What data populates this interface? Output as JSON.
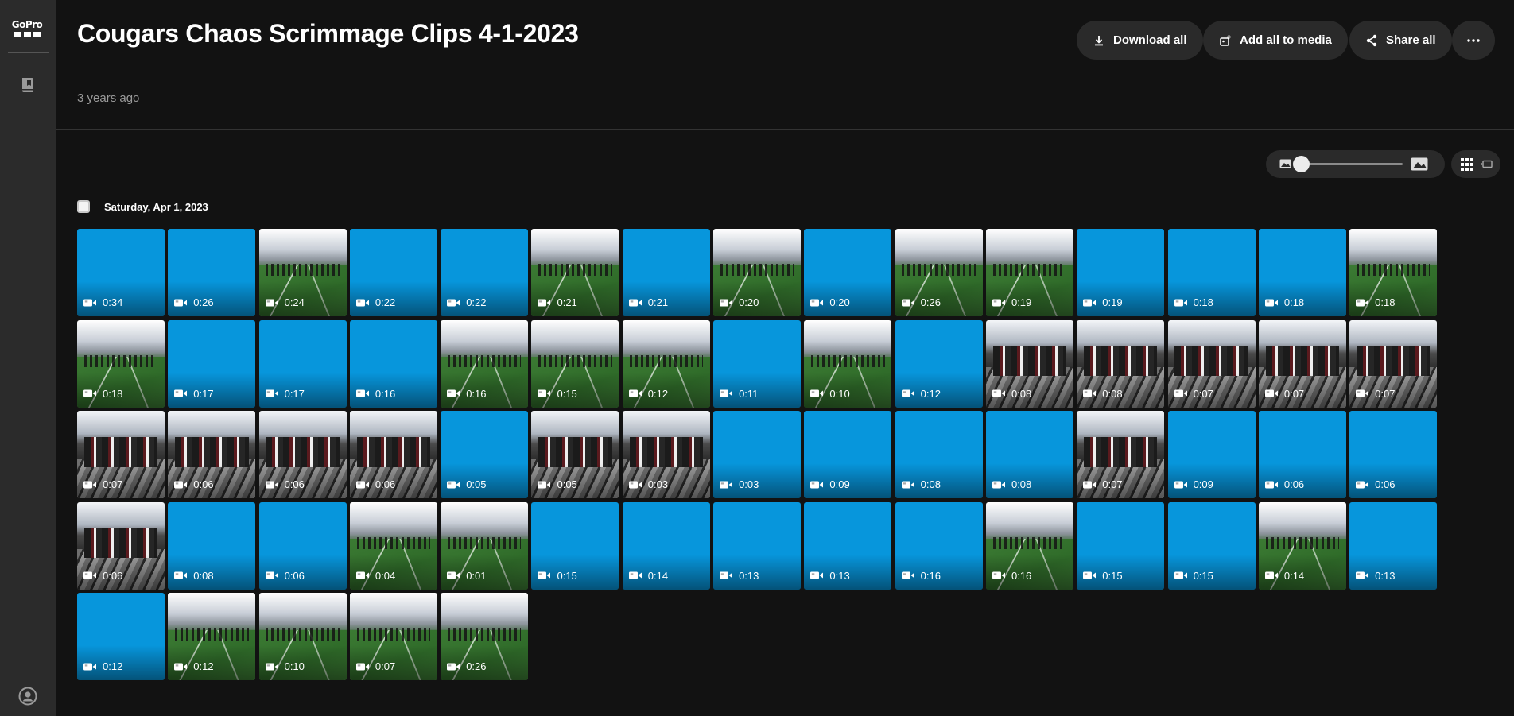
{
  "brand": {
    "logo_text": "GoPro"
  },
  "album": {
    "title": "Cougars Chaos Scrimmage Clips 4-1-2023",
    "created": "3 years ago"
  },
  "actions": {
    "download_all": "Download all",
    "add_all_to_media": "Add all to media",
    "share_all": "Share all"
  },
  "icons": {
    "sidebar": [
      "gopro-logo-icon",
      "bookmark-book-icon",
      "account-icon"
    ],
    "actions": [
      "download-icon",
      "add-to-media-icon",
      "share-icon",
      "more-dots-icon"
    ],
    "view": [
      "small-image-icon",
      "large-image-icon",
      "grid-view-icon",
      "single-view-icon"
    ],
    "tile": "video-camera-icon"
  },
  "colors": {
    "placeholder_tile": "#0796dc",
    "background": "#121212",
    "sidebar": "#2b2b2b",
    "button": "#2a2a2a"
  },
  "grid_size": 0.05,
  "group": {
    "date": "Saturday, Apr 1, 2023",
    "clips": [
      {
        "duration": "0:34",
        "thumb": "blue"
      },
      {
        "duration": "0:26",
        "thumb": "blue"
      },
      {
        "duration": "0:24",
        "thumb": "field"
      },
      {
        "duration": "0:22",
        "thumb": "blue"
      },
      {
        "duration": "0:22",
        "thumb": "blue"
      },
      {
        "duration": "0:21",
        "thumb": "field"
      },
      {
        "duration": "0:21",
        "thumb": "blue"
      },
      {
        "duration": "0:20",
        "thumb": "field"
      },
      {
        "duration": "0:20",
        "thumb": "blue"
      },
      {
        "duration": "0:26",
        "thumb": "field"
      },
      {
        "duration": "0:19",
        "thumb": "field"
      },
      {
        "duration": "0:19",
        "thumb": "blue"
      },
      {
        "duration": "0:18",
        "thumb": "blue"
      },
      {
        "duration": "0:18",
        "thumb": "blue"
      },
      {
        "duration": "0:18",
        "thumb": "field"
      },
      {
        "duration": "0:18",
        "thumb": "field"
      },
      {
        "duration": "0:17",
        "thumb": "blue"
      },
      {
        "duration": "0:17",
        "thumb": "blue"
      },
      {
        "duration": "0:16",
        "thumb": "blue"
      },
      {
        "duration": "0:16",
        "thumb": "field"
      },
      {
        "duration": "0:15",
        "thumb": "field"
      },
      {
        "duration": "0:12",
        "thumb": "field"
      },
      {
        "duration": "0:11",
        "thumb": "blue"
      },
      {
        "duration": "0:10",
        "thumb": "field"
      },
      {
        "duration": "0:12",
        "thumb": "blue"
      },
      {
        "duration": "0:08",
        "thumb": "crowd"
      },
      {
        "duration": "0:08",
        "thumb": "crowd"
      },
      {
        "duration": "0:07",
        "thumb": "crowd"
      },
      {
        "duration": "0:07",
        "thumb": "crowd"
      },
      {
        "duration": "0:07",
        "thumb": "crowd"
      },
      {
        "duration": "0:07",
        "thumb": "crowd"
      },
      {
        "duration": "0:06",
        "thumb": "crowd"
      },
      {
        "duration": "0:06",
        "thumb": "crowd"
      },
      {
        "duration": "0:06",
        "thumb": "crowd"
      },
      {
        "duration": "0:05",
        "thumb": "blue"
      },
      {
        "duration": "0:05",
        "thumb": "crowd"
      },
      {
        "duration": "0:03",
        "thumb": "crowd"
      },
      {
        "duration": "0:03",
        "thumb": "blue"
      },
      {
        "duration": "0:09",
        "thumb": "blue"
      },
      {
        "duration": "0:08",
        "thumb": "blue"
      },
      {
        "duration": "0:08",
        "thumb": "blue"
      },
      {
        "duration": "0:07",
        "thumb": "crowd"
      },
      {
        "duration": "0:09",
        "thumb": "blue"
      },
      {
        "duration": "0:06",
        "thumb": "blue"
      },
      {
        "duration": "0:06",
        "thumb": "blue"
      },
      {
        "duration": "0:06",
        "thumb": "crowd"
      },
      {
        "duration": "0:08",
        "thumb": "blue"
      },
      {
        "duration": "0:06",
        "thumb": "blue"
      },
      {
        "duration": "0:04",
        "thumb": "field"
      },
      {
        "duration": "0:01",
        "thumb": "field"
      },
      {
        "duration": "0:15",
        "thumb": "blue"
      },
      {
        "duration": "0:14",
        "thumb": "blue"
      },
      {
        "duration": "0:13",
        "thumb": "blue"
      },
      {
        "duration": "0:13",
        "thumb": "blue"
      },
      {
        "duration": "0:16",
        "thumb": "blue"
      },
      {
        "duration": "0:16",
        "thumb": "field"
      },
      {
        "duration": "0:15",
        "thumb": "blue"
      },
      {
        "duration": "0:15",
        "thumb": "blue"
      },
      {
        "duration": "0:14",
        "thumb": "field"
      },
      {
        "duration": "0:13",
        "thumb": "blue"
      },
      {
        "duration": "0:12",
        "thumb": "blue"
      },
      {
        "duration": "0:12",
        "thumb": "field"
      },
      {
        "duration": "0:10",
        "thumb": "field"
      },
      {
        "duration": "0:07",
        "thumb": "field"
      },
      {
        "duration": "0:26",
        "thumb": "field"
      }
    ]
  }
}
